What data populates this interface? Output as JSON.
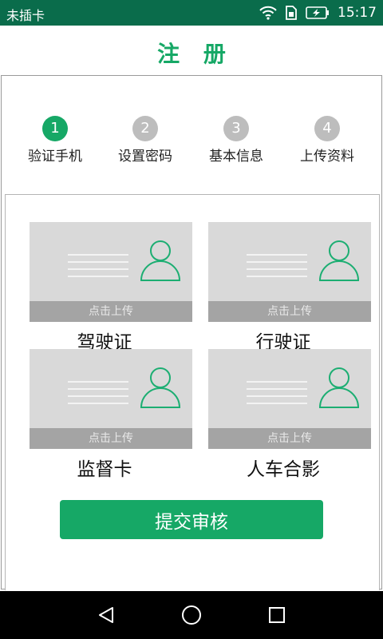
{
  "status_bar": {
    "carrier": "未插卡",
    "time": "15:17",
    "icons": [
      "wifi-icon",
      "sim-icon",
      "battery-charging-icon"
    ]
  },
  "header": {
    "title": "注 册"
  },
  "steps": [
    {
      "number": "1",
      "label": "验证手机",
      "active": true
    },
    {
      "number": "2",
      "label": "设置密码",
      "active": false
    },
    {
      "number": "3",
      "label": "基本信息",
      "active": false
    },
    {
      "number": "4",
      "label": "上传资料",
      "active": false
    }
  ],
  "upload_cards": [
    {
      "name": "驾驶证",
      "action": "点击上传"
    },
    {
      "name": "行驶证",
      "action": "点击上传"
    },
    {
      "name": "监督卡",
      "action": "点击上传"
    },
    {
      "name": "人车合影",
      "action": "点击上传"
    }
  ],
  "submit_button": {
    "label": "提交审核"
  },
  "colors": {
    "accent": "#16a866",
    "status_bar": "#0a6c4b",
    "step_inactive": "#bdbdbd",
    "card_bg": "#d9d9d9",
    "card_strip": "#a4a4a4"
  },
  "nav_bar": {
    "icons": [
      "back-icon",
      "home-icon",
      "recents-icon"
    ]
  }
}
